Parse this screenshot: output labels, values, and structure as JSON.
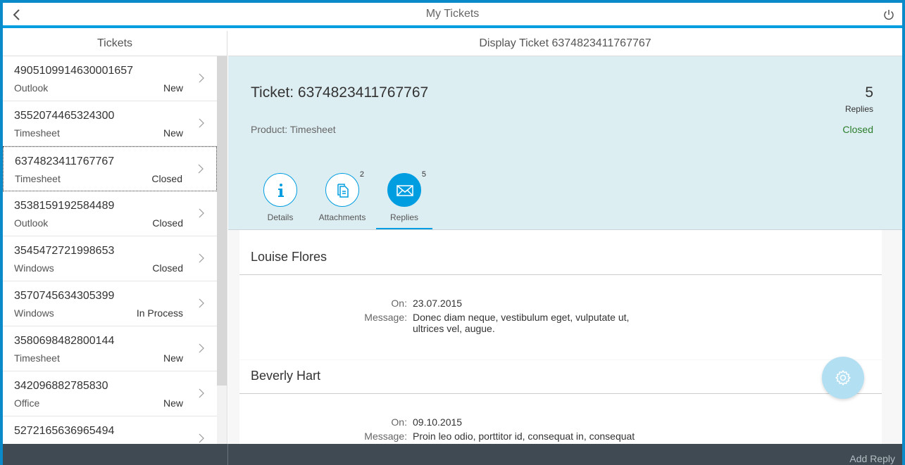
{
  "shell": {
    "title": "My Tickets"
  },
  "master": {
    "title": "Tickets",
    "items": [
      {
        "number": "4905109914630001657",
        "product": "Outlook",
        "status": "New"
      },
      {
        "number": "3552074465324300",
        "product": "Timesheet",
        "status": "New"
      },
      {
        "number": "6374823411767767",
        "product": "Timesheet",
        "status": "Closed"
      },
      {
        "number": "3538159192584489",
        "product": "Outlook",
        "status": "Closed"
      },
      {
        "number": "3545472721998653",
        "product": "Windows",
        "status": "Closed"
      },
      {
        "number": "3570745634305399",
        "product": "Windows",
        "status": "In Process"
      },
      {
        "number": "3580698482800144",
        "product": "Timesheet",
        "status": "New"
      },
      {
        "number": "342096882785830",
        "product": "Office",
        "status": "New"
      },
      {
        "number": "5272165636965494",
        "product": "",
        "status": ""
      }
    ]
  },
  "detail": {
    "title": "Display Ticket 6374823411767767",
    "header": {
      "title": "Ticket: 6374823411767767",
      "number": "5",
      "unit": "Replies",
      "attribute": "Product: Timesheet",
      "status": "Closed"
    },
    "tabs": [
      {
        "label": "Details",
        "count": ""
      },
      {
        "label": "Attachments",
        "count": "2"
      },
      {
        "label": "Replies",
        "count": "5"
      }
    ],
    "replies": [
      {
        "author": "Louise Flores",
        "on_label": "On:",
        "on": "23.07.2015",
        "message_label": "Message:",
        "message": "Donec diam neque, vestibulum eget, vulputate ut, ultrices vel, augue."
      },
      {
        "author": "Beverly Hart",
        "on_label": "On:",
        "on": "09.10.2015",
        "message_label": "Message:",
        "message": "Proin leo odio, porttitor id, consequat in, consequat ut,"
      }
    ]
  },
  "footer": {
    "add_reply": "Add Reply"
  },
  "colors": {
    "accent": "#009de0",
    "status_closed": "#2b7d2b",
    "footer": "#3f4a52",
    "header_bg": "#ddeef3"
  }
}
